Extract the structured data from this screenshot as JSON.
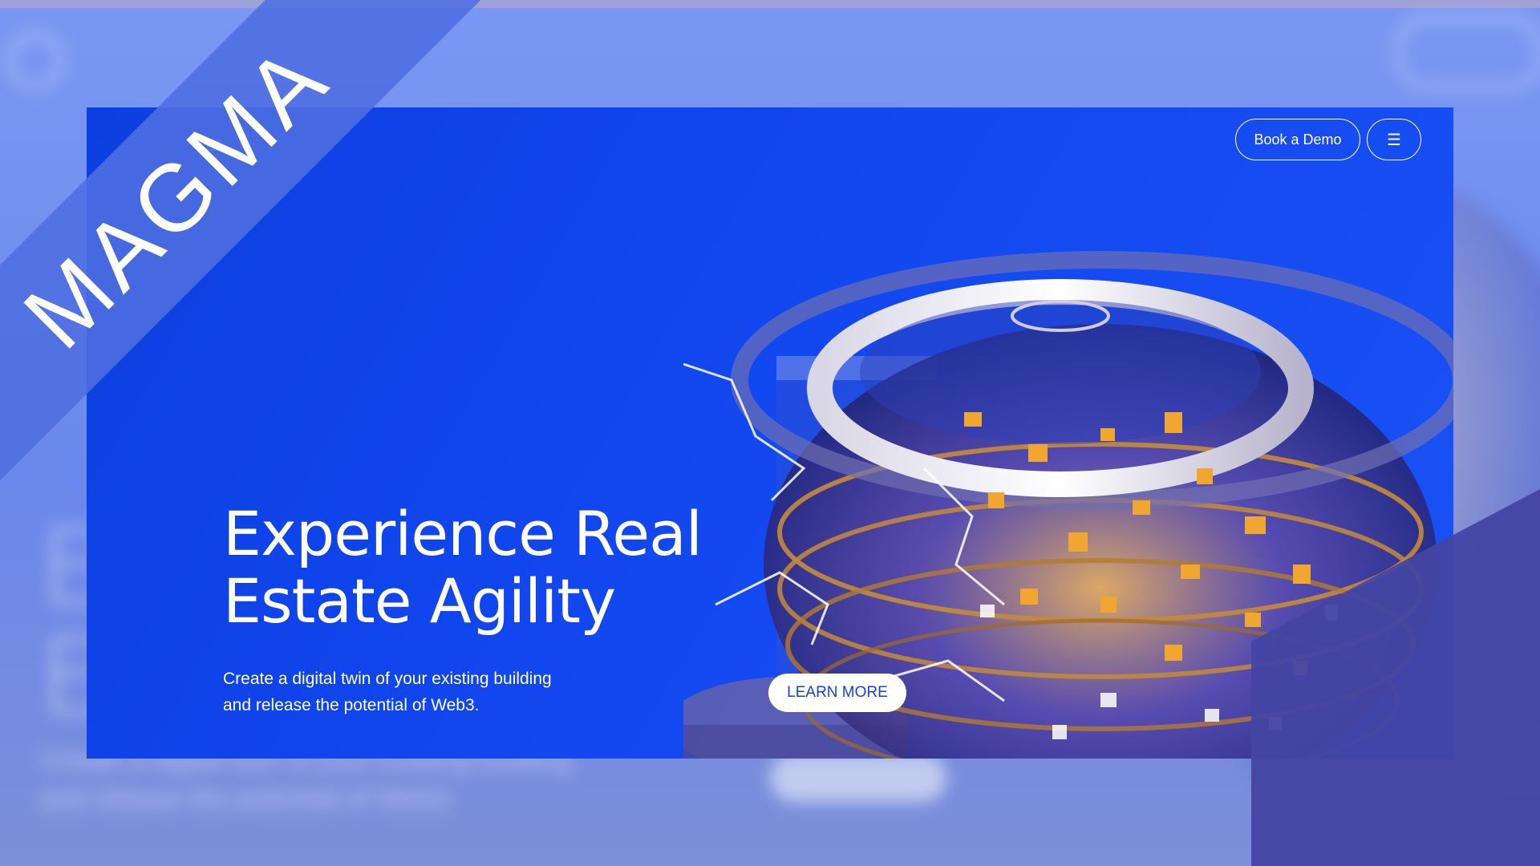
{
  "overlay": {
    "ribbon_text": "MAGMA"
  },
  "header": {
    "book_demo_label": "Book a Demo",
    "menu_icon": "hamburger-icon"
  },
  "hero": {
    "title_line1": "Experience Real",
    "title_line2": "Estate Agility",
    "subtitle_line1": "Create a digital twin of your existing building",
    "subtitle_line2": "and release the potential of Web3.",
    "cta_label": "LEARN MORE"
  },
  "colors": {
    "hero_background": "#1247f0",
    "ribbon": "#4e6ee1",
    "corner": "#4445a3",
    "accent_gold": "#f2a632"
  }
}
